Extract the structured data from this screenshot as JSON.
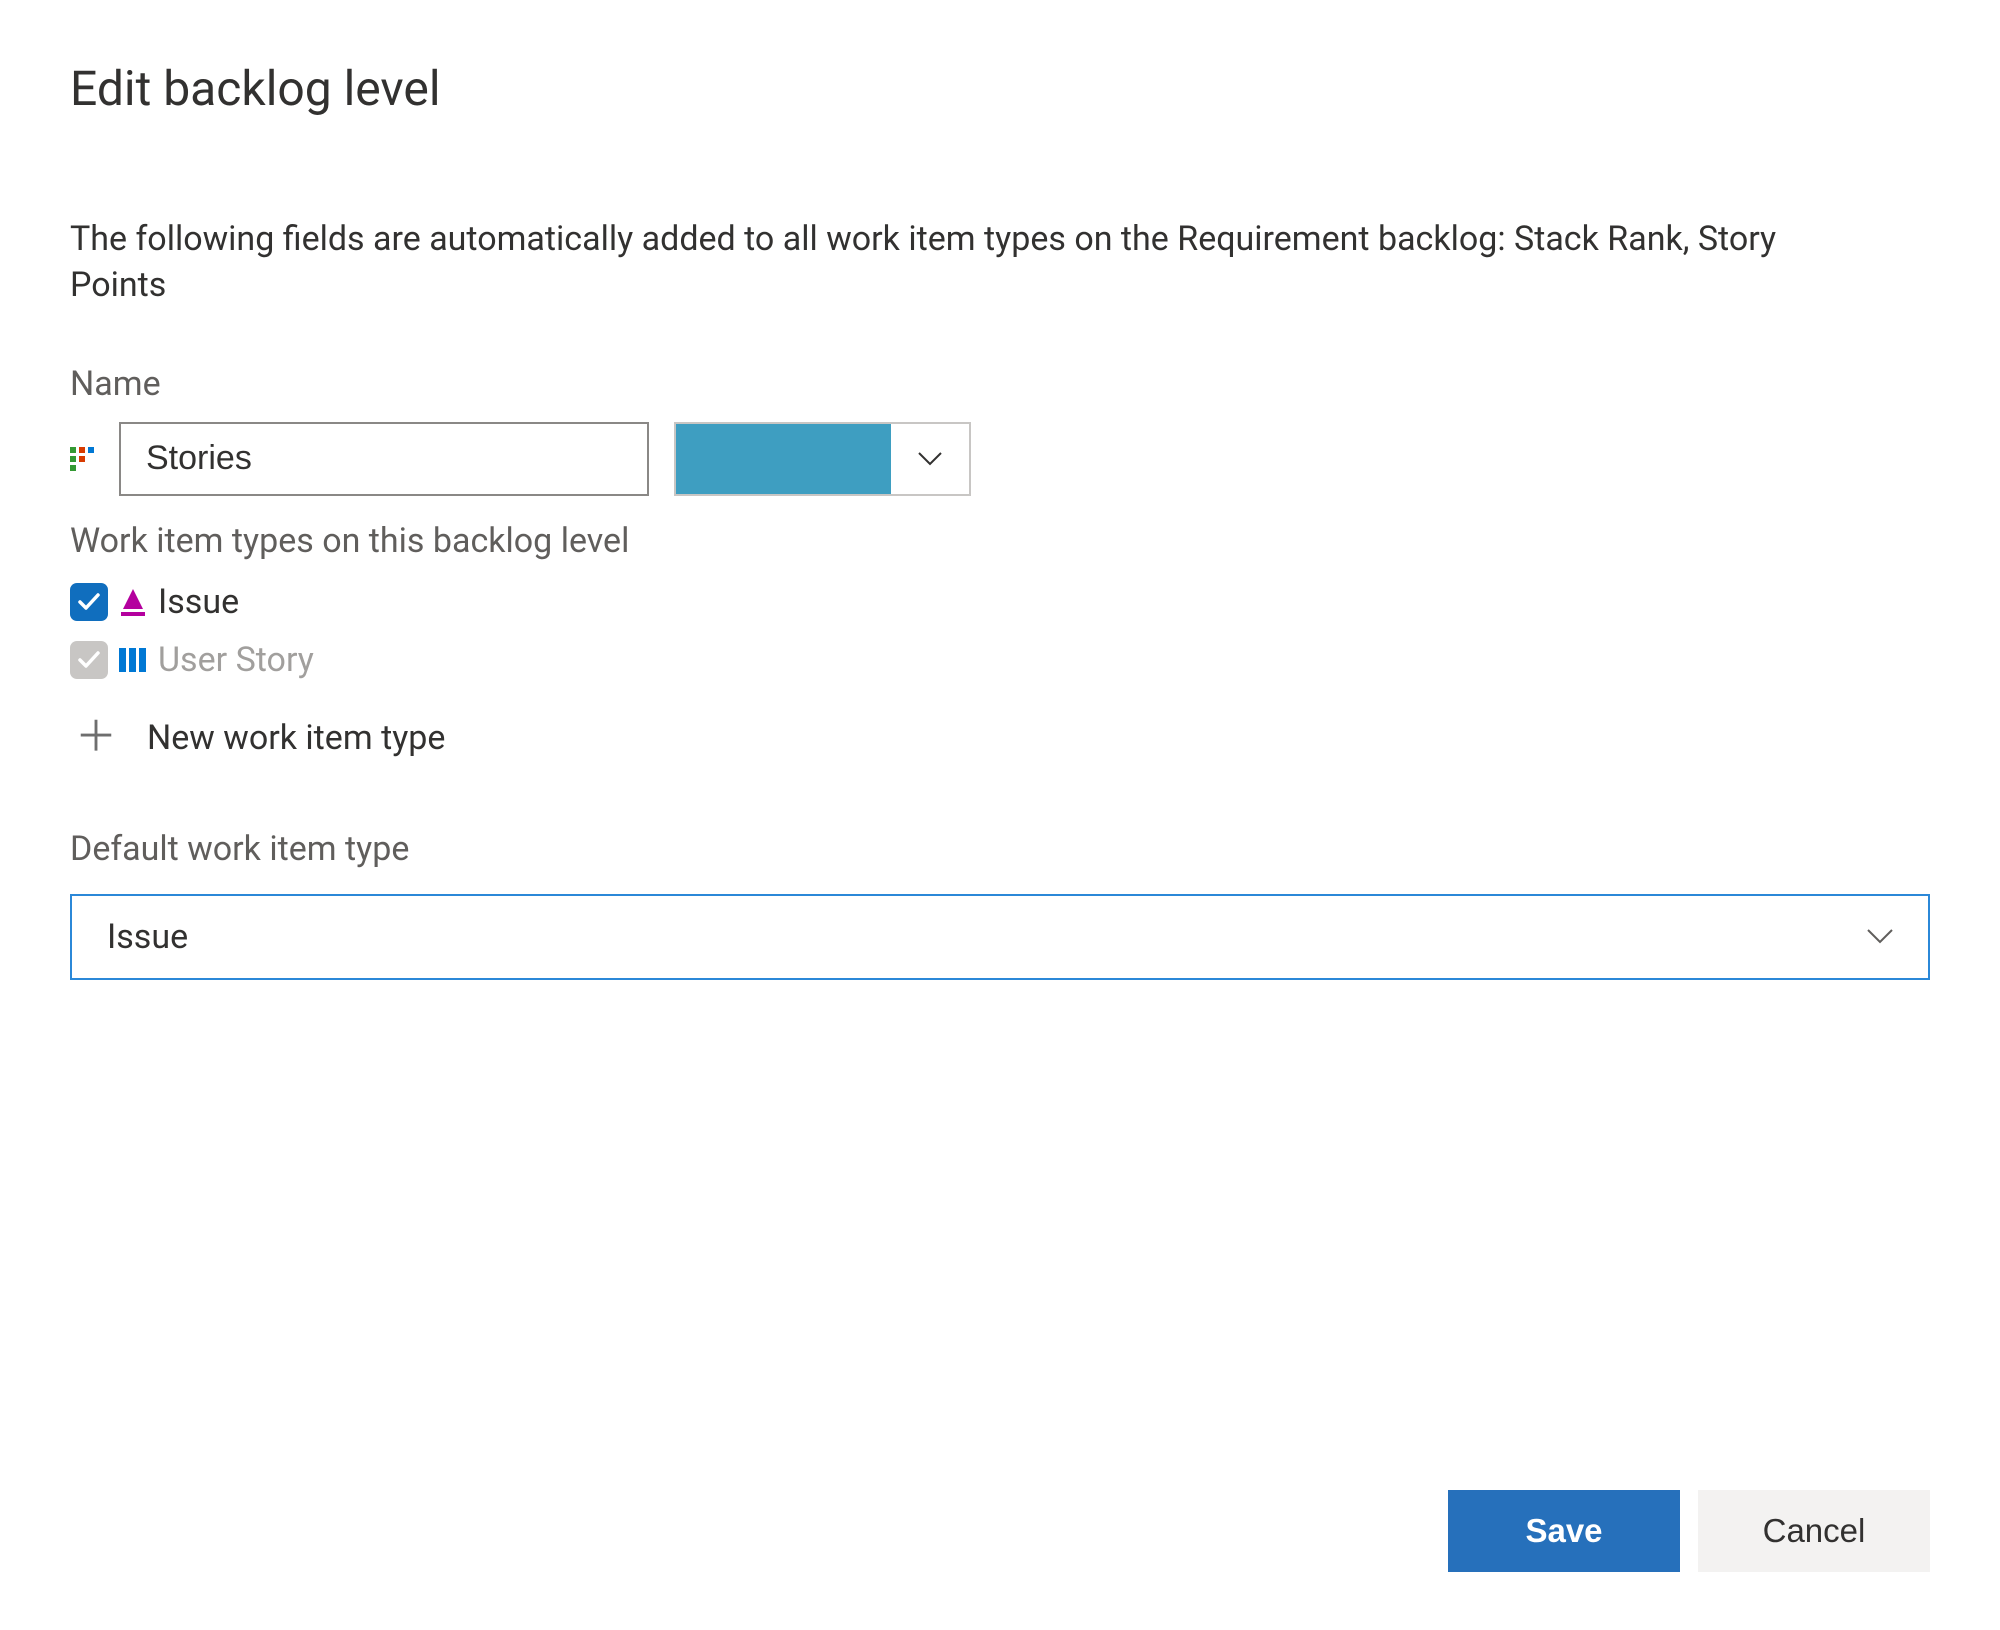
{
  "title": "Edit backlog level",
  "description": "The following fields are automatically added to all work item types on the Requirement backlog: Stack Rank, Story Points",
  "name_label": "Name",
  "name_value": "Stories",
  "color_value": "#3e9ec1",
  "backlog_icon_colors": {
    "a": "#339933",
    "b": "#d83b01",
    "c": "#0078d4"
  },
  "work_item_types_label": "Work item types on this backlog level",
  "work_item_types": [
    {
      "label": "Issue",
      "checked": true,
      "disabled": false,
      "icon": "issue",
      "icon_color": "#b4009e"
    },
    {
      "label": "User Story",
      "checked": true,
      "disabled": true,
      "icon": "user-story",
      "icon_color": "#0078d4"
    }
  ],
  "new_work_item_type_label": "New work item type",
  "default_type_label": "Default work item type",
  "default_type_value": "Issue",
  "buttons": {
    "save": "Save",
    "cancel": "Cancel"
  }
}
